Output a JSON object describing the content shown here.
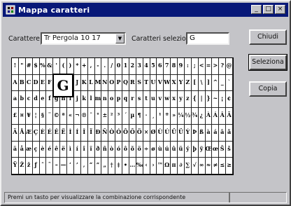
{
  "window": {
    "title": "Mappa caratteri",
    "buttons": {
      "minimize": "_",
      "maximize": "□",
      "close": "×"
    }
  },
  "font_select": {
    "label": "Carattere:",
    "value": "Tr Pergola 10 17"
  },
  "chars_input": {
    "label": "Caratteri selezionati:",
    "value": "G"
  },
  "actions": {
    "close": "Chiudi",
    "select": "Seleziona",
    "copy": "Copia"
  },
  "zoomed_char": "G",
  "char_rows": [
    [
      "!",
      "\"",
      "#",
      "$",
      "%",
      "&",
      "'",
      "(",
      ")",
      "*",
      "+",
      ",",
      "-",
      ".",
      "/",
      "0",
      "1",
      "2",
      "3",
      "4",
      "5",
      "6",
      "7",
      "8",
      "9",
      ":",
      ";",
      "<",
      "=",
      ">",
      "?",
      "@"
    ],
    [
      "A",
      "B",
      "C",
      "D",
      "E",
      "F",
      "G",
      "H",
      "I",
      "J",
      "K",
      "L",
      "M",
      "N",
      "O",
      "P",
      "Q",
      "R",
      "S",
      "T",
      "U",
      "V",
      "W",
      "X",
      "Y",
      "Z",
      "[",
      "\\",
      "]",
      "^",
      "_",
      "`"
    ],
    [
      "a",
      "b",
      "c",
      "d",
      "e",
      "f",
      "g",
      "h",
      "i",
      "j",
      "k",
      "l",
      "m",
      "n",
      "o",
      "p",
      "q",
      "r",
      "s",
      "t",
      "u",
      "v",
      "w",
      "x",
      "y",
      "z",
      "{",
      "|",
      "}",
      "~",
      "¡",
      "¢"
    ],
    [
      "£",
      "¤",
      "¥",
      "¦",
      "§",
      "¨",
      "©",
      "ª",
      "«",
      "¬",
      "®",
      "¯",
      "°",
      "±",
      "²",
      "³",
      "´",
      "µ",
      "¶",
      "·",
      "¸",
      "¹",
      "º",
      "»",
      "¼",
      "½",
      "¾",
      "¿",
      "À",
      "Á",
      "Â",
      "Ã"
    ],
    [
      "Ä",
      "Å",
      "Æ",
      "Ç",
      "È",
      "É",
      "Ê",
      "Ë",
      "Ì",
      "Í",
      "Î",
      "Ï",
      "Ð",
      "Ñ",
      "Ò",
      "Ó",
      "Ô",
      "Õ",
      "Ö",
      "×",
      "Ø",
      "Ù",
      "Ú",
      "Û",
      "Ü",
      "Ý",
      "Þ",
      "ß",
      "à",
      "á",
      "â",
      "ã"
    ],
    [
      "ä",
      "å",
      "æ",
      "ç",
      "è",
      "é",
      "ê",
      "ë",
      "ì",
      "í",
      "î",
      "ï",
      "ð",
      "ñ",
      "ò",
      "ó",
      "ô",
      "õ",
      "ö",
      "÷",
      "ø",
      "ù",
      "ú",
      "û",
      "ü",
      "ý",
      "þ",
      "ÿ",
      "Œ",
      "œ",
      "Š",
      "š"
    ],
    [
      "Ÿ",
      "Ž",
      "ž",
      "ƒ",
      "ˆ",
      "˜",
      "–",
      "—",
      "‘",
      "’",
      "‚",
      "“",
      "”",
      "„",
      "†",
      "‡",
      "•",
      "…",
      "‰",
      "‹",
      "›",
      "™",
      "Ω",
      "π",
      "∂",
      "∑",
      "√",
      "∞",
      "≈",
      "≠",
      "≤",
      "≥"
    ]
  ],
  "status": "Premi un tasto per visualizzare la combinazione corrispondente"
}
